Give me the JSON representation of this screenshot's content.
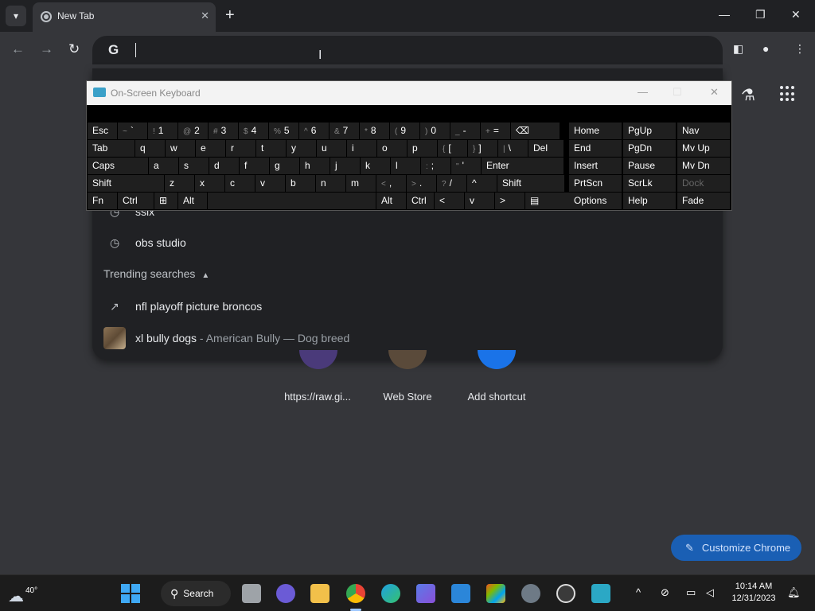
{
  "browser": {
    "tab_title": "New Tab",
    "omnibox_value": "",
    "new_tab_glyph": "+",
    "close_glyph": "✕"
  },
  "suggestions": {
    "partial_top": "ssix",
    "history_item": "obs studio",
    "trending_header": "Trending searches",
    "trending": [
      {
        "text": "nfl playoff picture broncos",
        "sub": ""
      },
      {
        "text": "xl bully dogs",
        "sub": " - American Bully — Dog breed"
      }
    ]
  },
  "shortcuts": [
    {
      "label": "https://raw.gi..."
    },
    {
      "label": "Web Store"
    },
    {
      "label": "Add shortcut"
    }
  ],
  "customize_label": "Customize Chrome",
  "osk": {
    "title": "On-Screen Keyboard",
    "row1": [
      {
        "main": "Esc"
      },
      {
        "alt": "~",
        "main": "`"
      },
      {
        "alt": "!",
        "main": "1"
      },
      {
        "alt": "@",
        "main": "2"
      },
      {
        "alt": "#",
        "main": "3"
      },
      {
        "alt": "$",
        "main": "4"
      },
      {
        "alt": "%",
        "main": "5"
      },
      {
        "alt": "^",
        "main": "6"
      },
      {
        "alt": "&",
        "main": "7"
      },
      {
        "alt": "*",
        "main": "8"
      },
      {
        "alt": "(",
        "main": "9"
      },
      {
        "alt": ")",
        "main": "0"
      },
      {
        "alt": "_",
        "main": "-"
      },
      {
        "alt": "+",
        "main": "="
      },
      {
        "main": "⌫"
      }
    ],
    "row2": [
      "Tab",
      "q",
      "w",
      "e",
      "r",
      "t",
      "y",
      "u",
      "i",
      "o",
      "p",
      "[",
      "]",
      "\\",
      "Del"
    ],
    "row2_alts": [
      "",
      "",
      "",
      "",
      "",
      "",
      "",
      "",
      "",
      "",
      "",
      "{",
      "}",
      "|",
      ""
    ],
    "row3": [
      "Caps",
      "a",
      "s",
      "d",
      "f",
      "g",
      "h",
      "j",
      "k",
      "l",
      ";",
      "'",
      "Enter"
    ],
    "row3_alts": [
      "",
      "",
      "",
      "",
      "",
      "",
      "",
      "",
      "",
      "",
      ":",
      "\"",
      ""
    ],
    "row4": [
      "Shift",
      "z",
      "x",
      "c",
      "v",
      "b",
      "n",
      "m",
      ",",
      ".",
      "/",
      "^",
      "Shift"
    ],
    "row4_alts": [
      "",
      "",
      "",
      "",
      "",
      "",
      "",
      "",
      "<",
      ">",
      "?",
      "",
      ""
    ],
    "row5": [
      "Fn",
      "Ctrl",
      "⊞",
      "Alt",
      "",
      "Alt",
      "Ctrl",
      "<",
      "v",
      ">",
      "▤"
    ],
    "nav": [
      [
        "Home",
        "PgUp",
        "Nav"
      ],
      [
        "End",
        "PgDn",
        "Mv Up"
      ],
      [
        "Insert",
        "Pause",
        "Mv Dn"
      ],
      [
        "PrtScn",
        "ScrLk",
        "Dock"
      ],
      [
        "Options",
        "Help",
        "Fade"
      ]
    ]
  },
  "taskbar": {
    "weather_temp": "40°",
    "search_label": "Search",
    "clock_time": "10:14 AM",
    "clock_date": "12/31/2023"
  },
  "colors": {
    "accent_blue": "#1a5fb4",
    "chrome_dark": "#202124",
    "toolbar": "#35363a"
  }
}
